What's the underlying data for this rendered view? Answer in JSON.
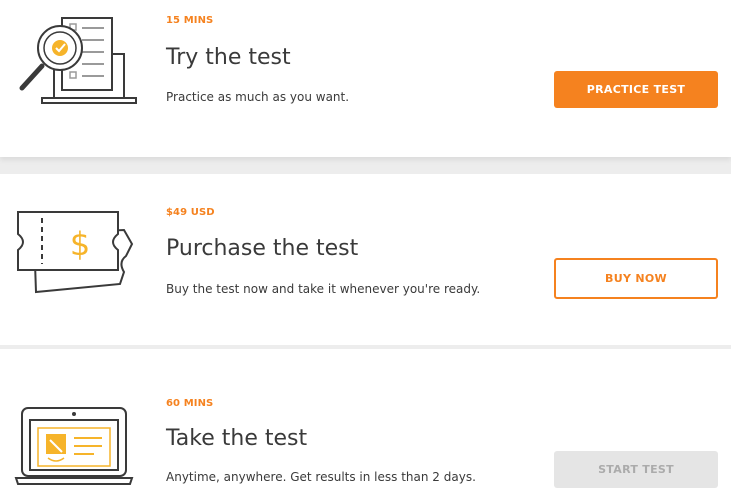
{
  "steps": [
    {
      "eyebrow": "15 MINS",
      "title": "Try the test",
      "description": "Practice as much as you want.",
      "button_label": "PRACTICE TEST",
      "illustration": "checklist-magnifier-icon"
    },
    {
      "eyebrow": "$49 USD",
      "title": "Purchase the test",
      "description": "Buy the test now and take it whenever you're ready.",
      "button_label": "BUY NOW",
      "illustration": "ticket-dollar-icon"
    },
    {
      "eyebrow": "60 MINS",
      "title": "Take the test",
      "description": "Anytime, anywhere. Get results in less than 2 days.",
      "button_label": "START TEST",
      "illustration": "laptop-certificate-icon"
    }
  ],
  "colors": {
    "accent": "#f5821f",
    "gold": "#f6b42a",
    "text": "#3a3a3a",
    "disabled_bg": "#e5e5e5",
    "disabled_text": "#ababab"
  }
}
